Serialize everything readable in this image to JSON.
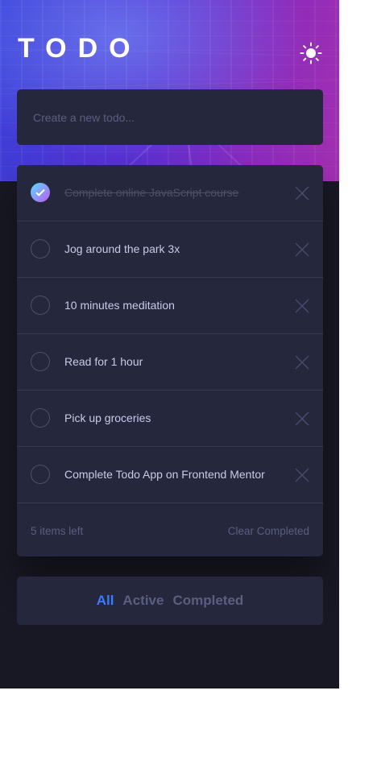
{
  "header": {
    "title": "TODO",
    "theme_toggle_icon": "sun-icon"
  },
  "new_todo": {
    "placeholder": "Create a new todo..."
  },
  "todos": [
    {
      "text": "Complete online JavaScript course",
      "completed": true
    },
    {
      "text": "Jog around the park 3x",
      "completed": false
    },
    {
      "text": "10 minutes meditation",
      "completed": false
    },
    {
      "text": "Read for 1 hour",
      "completed": false
    },
    {
      "text": "Pick up groceries",
      "completed": false
    },
    {
      "text": "Complete Todo App on Frontend Mentor",
      "completed": false
    }
  ],
  "footer": {
    "items_left": "5 items left",
    "clear_label": "Clear Completed"
  },
  "filters": {
    "items": [
      {
        "label": "All",
        "active": true
      },
      {
        "label": "Active",
        "active": false
      },
      {
        "label": "Completed",
        "active": false
      }
    ]
  },
  "colors": {
    "background": "#171823",
    "card": "#25273d",
    "accent": "#3a7cfd",
    "check_gradient_start": "#55ddff",
    "check_gradient_end": "#c058f3"
  }
}
